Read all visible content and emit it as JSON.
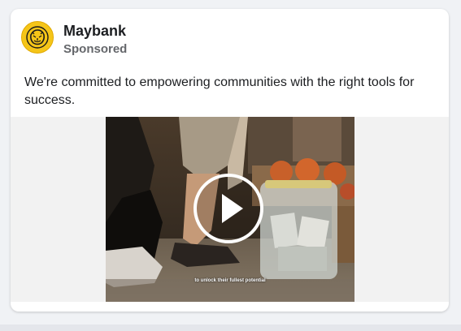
{
  "post": {
    "advertiser": "Maybank",
    "sponsored_label": "Sponsored",
    "text": "We're committed to empowering communities with the right tools for success.",
    "avatar_icon": "tiger-logo-icon"
  },
  "video": {
    "subtitle": "to unlock their fullest potential",
    "play_icon": "play-icon"
  },
  "colors": {
    "brand_yellow": "#f5c518",
    "text_primary": "#1c1e21",
    "text_secondary": "#65676b",
    "media_background": "#f2f2f2"
  }
}
